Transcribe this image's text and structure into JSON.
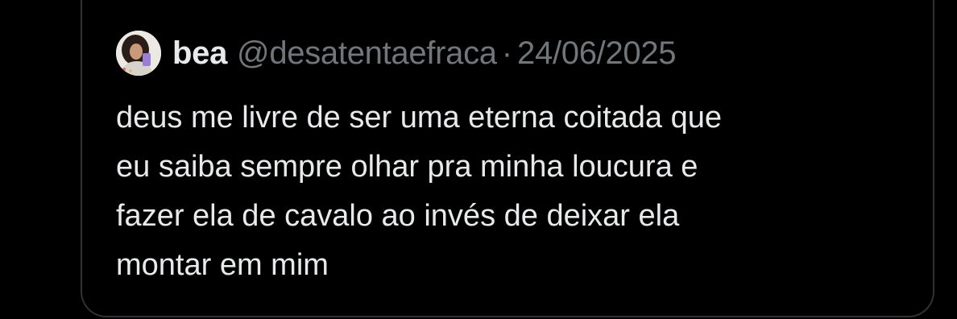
{
  "quoted_post": {
    "author": {
      "display_name": "bea",
      "handle": "@desatentaefraca",
      "avatar_icon": "profile-photo-icon"
    },
    "separator": "·",
    "date": "24/06/2025",
    "text": "deus me livre de ser uma eterna coitada que\neu saiba sempre olhar pra minha loucura e\nfazer ela de cavalo ao invés de deixar ela\nmontar em mim"
  },
  "colors": {
    "background": "#000000",
    "text_primary": "#e7e9ea",
    "text_secondary": "#71767b",
    "border": "#2f3336"
  }
}
